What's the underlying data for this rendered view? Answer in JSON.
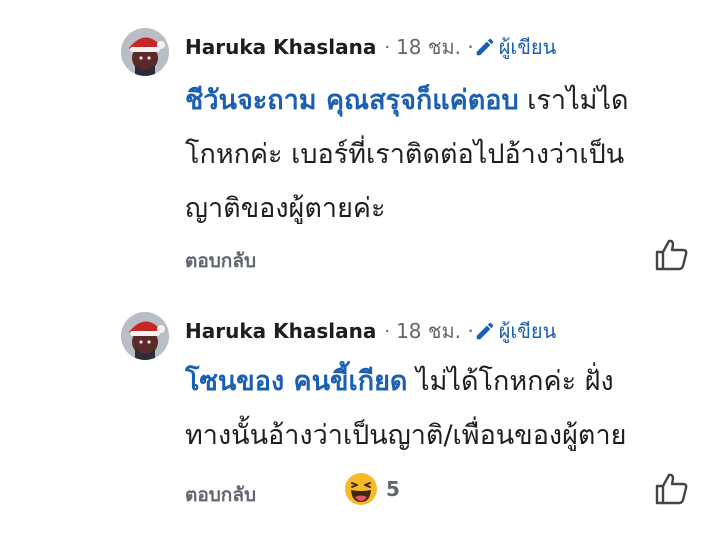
{
  "comments": [
    {
      "author": "Haruka Khaslana",
      "separator": "·",
      "time": "18 ชม. ·",
      "author_badge": "ผู้เขียน",
      "mention": "ชีวันจะถาม คุณสรุจก็แค่ตอบ",
      "text_line1_rest": " เราไม่ได",
      "text_line2": "โกหกค่ะ เบอร์ที่เราติดต่อไปอ้างว่าเป็น",
      "text_line3": "ญาติของผู้ตายค่ะ",
      "reply_label": "ตอบกลับ",
      "avatar_icon": "santa-hat-avatar",
      "like_icon": "thumbs-up-icon"
    },
    {
      "author": "Haruka Khaslana",
      "separator": "·",
      "time": "18 ชม. ·",
      "author_badge": "ผู้เขียน",
      "mention": "โซนของ คนขี้เกียด",
      "text_line1_rest": " ไม่ได้โกหกค่ะ ฝั่ง",
      "text_line2": "ทางนั้นอ้างว่าเป็นญาติ/เพื่อนของผู้ตาย",
      "reply_label": "ตอบกลับ",
      "reaction_emoji": "laughing-emoji",
      "reaction_count": "5",
      "avatar_icon": "santa-hat-avatar",
      "like_icon": "thumbs-up-icon"
    }
  ],
  "colors": {
    "mention": "#1a5fb4",
    "secondary_text": "#65676b",
    "badge": "#1a5fb4"
  }
}
